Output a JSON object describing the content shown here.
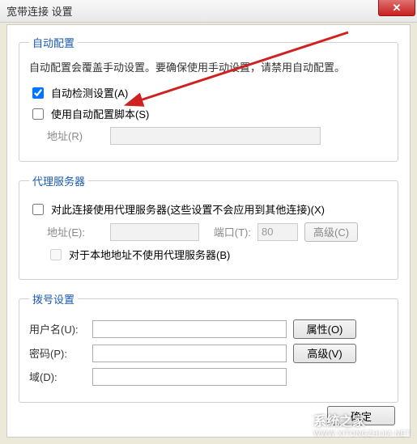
{
  "window": {
    "title": "宽带连接 设置"
  },
  "auto": {
    "legend": "自动配置",
    "desc": "自动配置会覆盖手动设置。要确保使用手动设置，请禁用自动配置。",
    "detect_label": "自动检测设置(A)",
    "detect_checked": true,
    "script_label": "使用自动配置脚本(S)",
    "script_checked": false,
    "addr_label": "地址(R)",
    "addr_value": ""
  },
  "proxy": {
    "legend": "代理服务器",
    "use_label": "对此连接使用代理服务器(这些设置不会应用到其他连接)(X)",
    "use_checked": false,
    "addr_label": "地址(E):",
    "addr_value": "",
    "port_label": "端口(T):",
    "port_value": "80",
    "advanced_label": "高级(C)",
    "bypass_label": "对于本地地址不使用代理服务器(B)",
    "bypass_checked": false
  },
  "dial": {
    "legend": "拨号设置",
    "user_label": "用户名(U):",
    "user_value": "",
    "pass_label": "密码(P):",
    "pass_value": "",
    "domain_label": "域(D):",
    "domain_value": "",
    "props_label": "属性(O)",
    "advanced_label": "高级(V)"
  },
  "buttons": {
    "ok": "确定"
  },
  "watermark": {
    "text": "系统之家",
    "url": "WWW.XITONGZHIJIA.NET"
  }
}
